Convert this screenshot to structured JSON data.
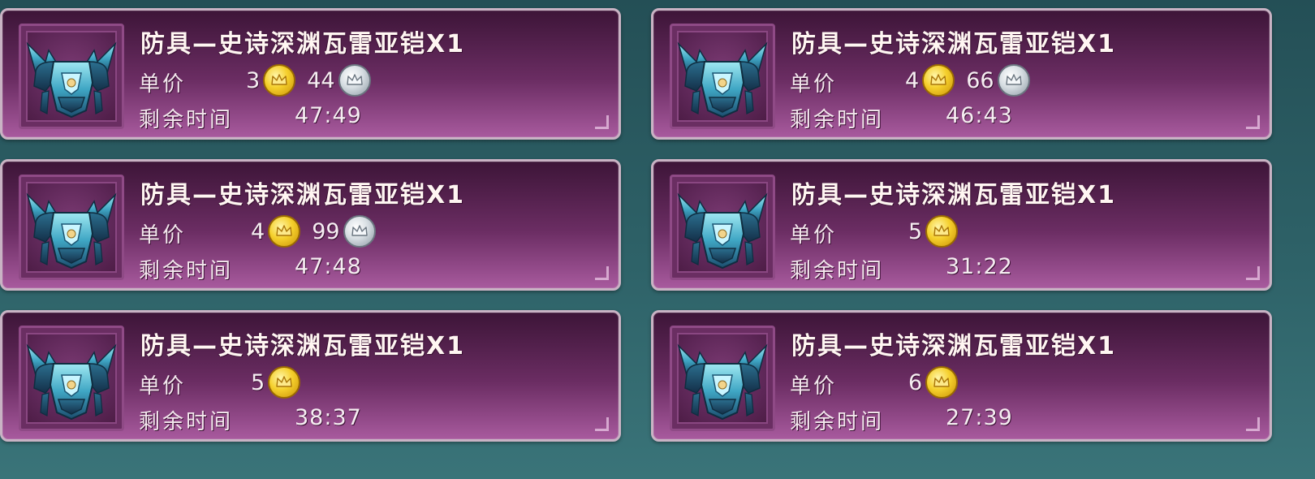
{
  "labels": {
    "price": "单价",
    "time_left": "剩余时间"
  },
  "listings": [
    {
      "title": "防具—史诗深渊瓦雷亚铠X1",
      "gold": "3",
      "silver": "44",
      "time": "47:49"
    },
    {
      "title": "防具—史诗深渊瓦雷亚铠X1",
      "gold": "4",
      "silver": "66",
      "time": "46:43"
    },
    {
      "title": "防具—史诗深渊瓦雷亚铠X1",
      "gold": "4",
      "silver": "99",
      "time": "47:48"
    },
    {
      "title": "防具—史诗深渊瓦雷亚铠X1",
      "gold": "5",
      "silver": null,
      "time": "31:22"
    },
    {
      "title": "防具—史诗深渊瓦雷亚铠X1",
      "gold": "5",
      "silver": null,
      "time": "38:37"
    },
    {
      "title": "防具—史诗深渊瓦雷亚铠X1",
      "gold": "6",
      "silver": null,
      "time": "27:39"
    }
  ],
  "icons": {
    "item": "armor-icon",
    "gold": "gold-coin-icon",
    "silver": "silver-coin-icon"
  },
  "colors": {
    "card_top": "#3d1538",
    "card_bottom": "#a85a9e",
    "background": "#2e6268",
    "gold": "#f5cf2c",
    "silver": "#d6dde2"
  }
}
